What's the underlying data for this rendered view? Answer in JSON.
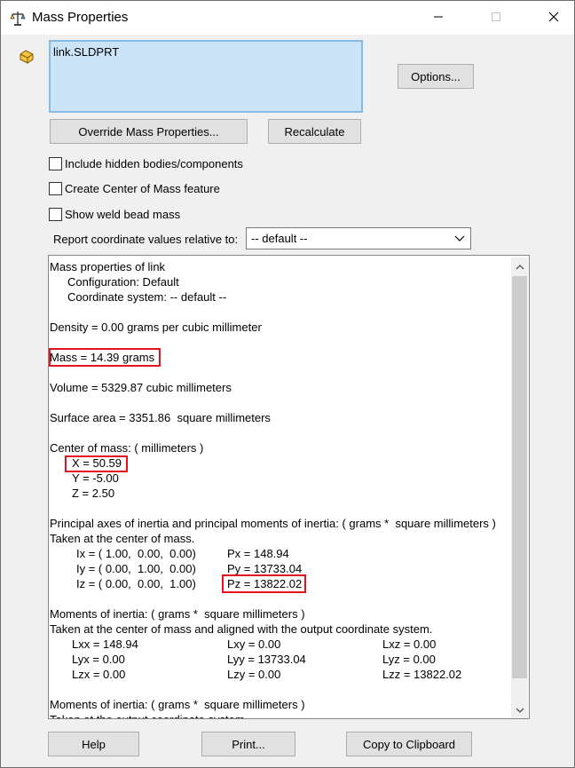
{
  "window": {
    "title": "Mass Properties"
  },
  "selection": {
    "item": "link.SLDPRT"
  },
  "buttons": {
    "options": "Options...",
    "override": "Override Mass Properties...",
    "recalculate": "Recalculate",
    "help": "Help",
    "print": "Print...",
    "copy": "Copy to Clipboard"
  },
  "options": {
    "include_hidden": "Include hidden bodies/components",
    "center_of_mass_feature": "Create Center of Mass feature",
    "weld_bead": "Show weld bead mass"
  },
  "coordinate": {
    "label": "Report coordinate values relative to:",
    "value": "-- default --"
  },
  "results": {
    "header": "Mass properties of link",
    "configuration": "Configuration: Default",
    "coordinate_system": "Coordinate system: -- default --",
    "density": "Density = 0.00 grams per cubic millimeter",
    "mass": "Mass = 14.39 grams",
    "volume": "Volume = 5329.87 cubic millimeters",
    "surface_area": "Surface area = 3351.86  square millimeters",
    "com_header": "Center of mass: ( millimeters )",
    "com_x": "X = 50.59",
    "com_y": "Y = -5.00",
    "com_z": "Z = 2.50",
    "principal_header": "Principal axes of inertia and principal moments of inertia: ( grams *  square millimeters )",
    "taken_at_com": "Taken at the center of mass.",
    "ix": "Ix = ( 1.00,  0.00,  0.00)",
    "iy": "Iy = ( 0.00,  1.00,  0.00)",
    "iz": "Iz = ( 0.00,  0.00,  1.00)",
    "px": "Px = 148.94",
    "py": "Py = 13733.04",
    "pz": "Pz = 13822.02",
    "moments_header": "Moments of inertia: ( grams *  square millimeters )",
    "moments_sub": "Taken at the center of mass and aligned with the output coordinate system.",
    "lxx": "Lxx = 148.94",
    "lxy": "Lxy = 0.00",
    "lxz": "Lxz = 0.00",
    "lyx": "Lyx = 0.00",
    "lyy": "Lyy = 13733.04",
    "lyz": "Lyz = 0.00",
    "lzx": "Lzx = 0.00",
    "lzy": "Lzy = 0.00",
    "lzz": "Lzz = 13822.02",
    "moments2_header": "Moments of inertia: ( grams *  square millimeters )",
    "moments2_sub": "Taken at the output coordinate system."
  },
  "colors": {
    "highlight": "#e3121f",
    "selection_bg": "#cce4f7"
  },
  "icons": {
    "app": "mass-properties-icon",
    "part": "part-icon",
    "minimize": "minimize-icon",
    "maximize": "maximize-icon",
    "close": "close-icon",
    "dropdown": "chevron-down-icon",
    "scroll_up": "chevron-up-icon",
    "scroll_down": "chevron-down-icon"
  }
}
